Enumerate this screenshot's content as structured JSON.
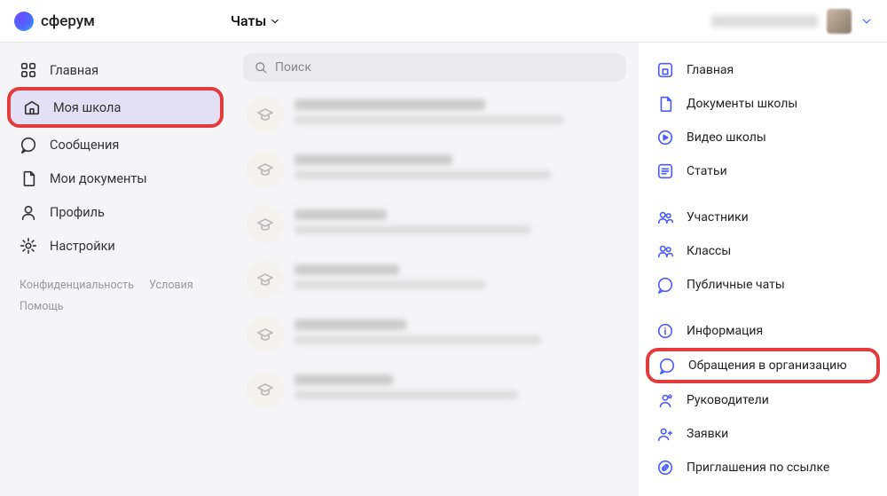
{
  "header": {
    "brand": "сферум",
    "nav_label": "Чаты"
  },
  "sidebar": {
    "items": [
      {
        "label": "Главная",
        "icon": "grid"
      },
      {
        "label": "Моя школа",
        "icon": "school",
        "active": true,
        "highlight": true
      },
      {
        "label": "Сообщения",
        "icon": "chat"
      },
      {
        "label": "Мои документы",
        "icon": "doc"
      },
      {
        "label": "Профиль",
        "icon": "user"
      },
      {
        "label": "Настройки",
        "icon": "gear"
      }
    ],
    "footer": {
      "privacy": "Конфиденциальность",
      "terms": "Условия",
      "help": "Помощь"
    }
  },
  "search": {
    "placeholder": "Поиск"
  },
  "rightbar": {
    "groups": [
      [
        {
          "label": "Главная",
          "icon": "home-sq"
        },
        {
          "label": "Документы школы",
          "icon": "doc"
        },
        {
          "label": "Видео школы",
          "icon": "play"
        },
        {
          "label": "Статьи",
          "icon": "list"
        }
      ],
      [
        {
          "label": "Участники",
          "icon": "people"
        },
        {
          "label": "Классы",
          "icon": "people"
        },
        {
          "label": "Публичные чаты",
          "icon": "chat"
        }
      ],
      [
        {
          "label": "Информация",
          "icon": "info"
        },
        {
          "label": "Обращения в организацию",
          "icon": "chat",
          "highlight": true
        },
        {
          "label": "Руководители",
          "icon": "star-user"
        },
        {
          "label": "Заявки",
          "icon": "user-plus"
        },
        {
          "label": "Приглашения по ссылке",
          "icon": "link"
        }
      ]
    ]
  }
}
